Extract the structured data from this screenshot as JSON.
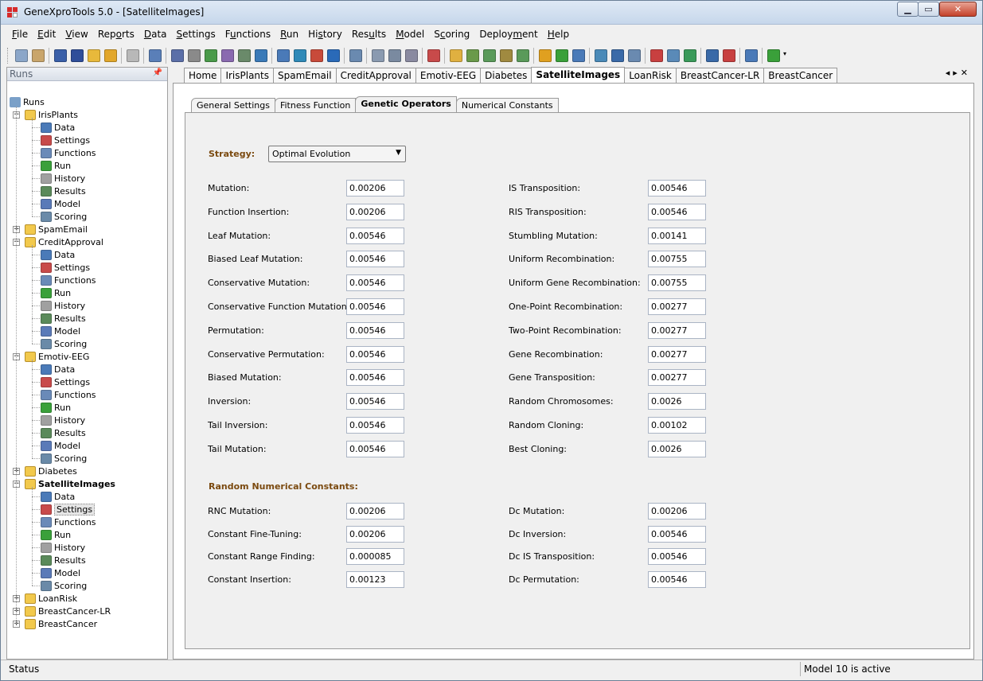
{
  "window": {
    "title": "GeneXproTools 5.0 - [SatelliteImages]"
  },
  "menu": [
    {
      "u": "F",
      "rest": "ile"
    },
    {
      "u": "E",
      "rest": "dit"
    },
    {
      "u": "V",
      "rest": "iew"
    },
    {
      "pre": "Rep",
      "u": "o",
      "rest": "rts"
    },
    {
      "u": "D",
      "rest": "ata"
    },
    {
      "u": "S",
      "rest": "ettings"
    },
    {
      "pre": "F",
      "u": "u",
      "rest": "nctions"
    },
    {
      "u": "R",
      "rest": "un"
    },
    {
      "pre": "Hi",
      "u": "s",
      "rest": "tory"
    },
    {
      "pre": "Res",
      "u": "u",
      "rest": "lts"
    },
    {
      "u": "M",
      "rest": "odel"
    },
    {
      "pre": "S",
      "u": "c",
      "rest": "oring"
    },
    {
      "pre": "Deploy",
      "u": "m",
      "rest": "ent"
    },
    {
      "u": "H",
      "rest": "elp"
    }
  ],
  "runs_panel": {
    "title": "Runs",
    "root": "Runs",
    "projects": [
      {
        "name": "IrisPlants",
        "expanded": true,
        "children": [
          "Data",
          "Settings",
          "Functions",
          "Run",
          "History",
          "Results",
          "Model",
          "Scoring"
        ]
      },
      {
        "name": "SpamEmail",
        "expanded": false,
        "children": []
      },
      {
        "name": "CreditApproval",
        "expanded": true,
        "children": [
          "Data",
          "Settings",
          "Functions",
          "Run",
          "History",
          "Results",
          "Model",
          "Scoring"
        ]
      },
      {
        "name": "Emotiv-EEG",
        "expanded": true,
        "children": [
          "Data",
          "Settings",
          "Functions",
          "Run",
          "History",
          "Results",
          "Model",
          "Scoring"
        ]
      },
      {
        "name": "Diabetes",
        "expanded": false,
        "children": []
      },
      {
        "name": "SatelliteImages",
        "expanded": true,
        "bold": true,
        "selected_child": "Settings",
        "children": [
          "Data",
          "Settings",
          "Functions",
          "Run",
          "History",
          "Results",
          "Model",
          "Scoring"
        ]
      },
      {
        "name": "LoanRisk",
        "expanded": false,
        "children": []
      },
      {
        "name": "BreastCancer-LR",
        "expanded": false,
        "children": []
      },
      {
        "name": "BreastCancer",
        "expanded": false,
        "children": []
      }
    ]
  },
  "doc_tabs": [
    "Home",
    "IrisPlants",
    "SpamEmail",
    "CreditApproval",
    "Emotiv-EEG",
    "Diabetes",
    "SatelliteImages",
    "LoanRisk",
    "BreastCancer-LR",
    "BreastCancer"
  ],
  "doc_tab_active": "SatelliteImages",
  "sub_tabs": [
    "General Settings",
    "Fitness Function",
    "Genetic Operators",
    "Numerical Constants"
  ],
  "sub_tab_active": "Genetic Operators",
  "strategy": {
    "label": "Strategy:",
    "value": "Optimal Evolution"
  },
  "operators_left": [
    {
      "label": "Mutation:",
      "value": "0.00206"
    },
    {
      "label": "Function Insertion:",
      "value": "0.00206"
    },
    {
      "label": "Leaf Mutation:",
      "value": "0.00546"
    },
    {
      "label": "Biased Leaf Mutation:",
      "value": "0.00546"
    },
    {
      "label": "Conservative Mutation:",
      "value": "0.00546"
    },
    {
      "label": "Conservative Function Mutation:",
      "value": "0.00546"
    },
    {
      "label": "Permutation:",
      "value": "0.00546"
    },
    {
      "label": "Conservative Permutation:",
      "value": "0.00546"
    },
    {
      "label": "Biased Mutation:",
      "value": "0.00546"
    },
    {
      "label": "Inversion:",
      "value": "0.00546"
    },
    {
      "label": "Tail Inversion:",
      "value": "0.00546"
    },
    {
      "label": "Tail Mutation:",
      "value": "0.00546"
    }
  ],
  "operators_right": [
    {
      "label": "IS Transposition:",
      "value": "0.00546"
    },
    {
      "label": "RIS Transposition:",
      "value": "0.00546"
    },
    {
      "label": "Stumbling Mutation:",
      "value": "0.00141"
    },
    {
      "label": "Uniform Recombination:",
      "value": "0.00755"
    },
    {
      "label": "Uniform Gene Recombination:",
      "value": "0.00755"
    },
    {
      "label": "One-Point Recombination:",
      "value": "0.00277"
    },
    {
      "label": "Two-Point Recombination:",
      "value": "0.00277"
    },
    {
      "label": "Gene Recombination:",
      "value": "0.00277"
    },
    {
      "label": "Gene Transposition:",
      "value": "0.00277"
    },
    {
      "label": "Random Chromosomes:",
      "value": "0.0026"
    },
    {
      "label": "Random Cloning:",
      "value": "0.00102"
    },
    {
      "label": "Best Cloning:",
      "value": "0.0026"
    }
  ],
  "rnc": {
    "title": "Random Numerical Constants:",
    "left": [
      {
        "label": "RNC Mutation:",
        "value": "0.00206"
      },
      {
        "label": "Constant Fine-Tuning:",
        "value": "0.00206"
      },
      {
        "label": "Constant Range Finding:",
        "value": "0.000085"
      },
      {
        "label": "Constant Insertion:",
        "value": "0.00123"
      }
    ],
    "right": [
      {
        "label": "Dc Mutation:",
        "value": "0.00206"
      },
      {
        "label": "Dc Inversion:",
        "value": "0.00546"
      },
      {
        "label": "Dc IS Transposition:",
        "value": "0.00546"
      },
      {
        "label": "Dc Permutation:",
        "value": "0.00546"
      }
    ]
  },
  "status": {
    "left": "Status",
    "right": "Model 10 is active"
  },
  "icons": {
    "folder_color": "#f2c94c",
    "data": "data-icon",
    "settings": "settings-icon",
    "functions": "functions-icon",
    "run": "run-icon",
    "history": "history-icon",
    "results": "results-icon",
    "model": "model-icon",
    "scoring": "scoring-icon"
  }
}
